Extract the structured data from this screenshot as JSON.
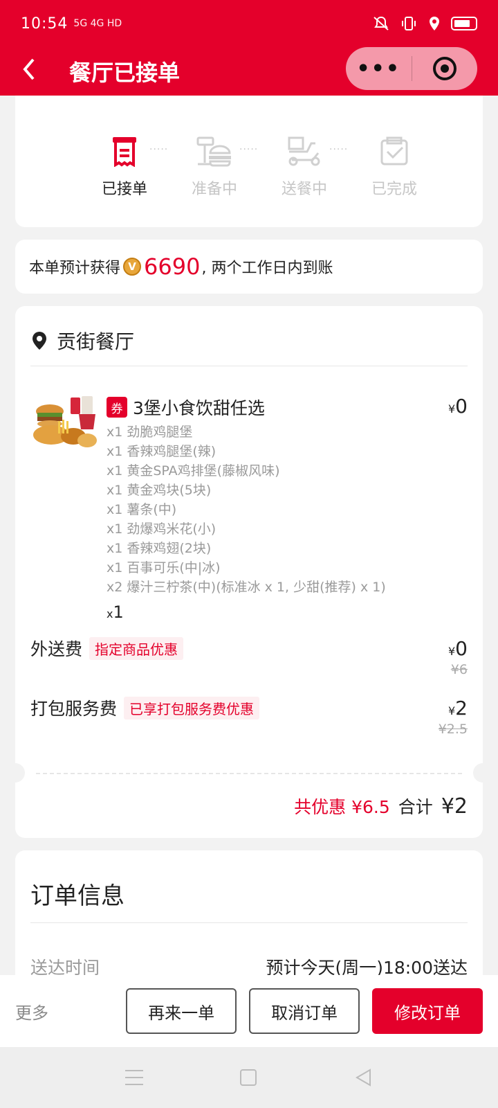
{
  "status_bar": {
    "time": "10:54",
    "signal_text": "5G 4G HD",
    "icons": [
      "mute-icon",
      "vibrate-icon",
      "location-icon",
      "battery-icon"
    ]
  },
  "nav": {
    "title": "餐厅已接单",
    "back_icon": "chevron-left-icon",
    "more_icon": "more-dots-icon",
    "close_icon": "target-icon"
  },
  "progress": {
    "steps": [
      {
        "label": "已接单",
        "icon": "receipt-icon",
        "active": true
      },
      {
        "label": "准备中",
        "icon": "burger-icon",
        "active": false
      },
      {
        "label": "送餐中",
        "icon": "delivery-scooter-icon",
        "active": false
      },
      {
        "label": "已完成",
        "icon": "done-check-icon",
        "active": false
      }
    ],
    "dots": "·····"
  },
  "points": {
    "prefix": "本单预计获得",
    "coin": "V",
    "amount": "6690",
    "suffix": ", 两个工作日内到账"
  },
  "order": {
    "restaurant": "贡街餐厅",
    "item": {
      "coupon": "券",
      "name": "3堡小食饮甜任选",
      "currency": "¥",
      "price": "0",
      "sub_items": [
        "x1 劲脆鸡腿堡",
        "x1 香辣鸡腿堡(辣)",
        "x1 黄金SPA鸡排堡(藤椒风味)",
        "x1 黄金鸡块(5块)",
        "x1 薯条(中)",
        "x1 劲爆鸡米花(小)",
        "x1 香辣鸡翅(2块)",
        "x1 百事可乐(中|冰)",
        "x2 爆汁三柠茶(中)(标准冰 x 1, 少甜(推荐) x 1)"
      ],
      "qty_prefix": "x",
      "qty": "1"
    },
    "delivery_fee": {
      "label": "外送费",
      "tag": "指定商品优惠",
      "currency": "¥",
      "price": "0",
      "original": "¥6"
    },
    "packing_fee": {
      "label": "打包服务费",
      "tag": "已享打包服务费优惠",
      "currency": "¥",
      "price": "2",
      "original": "¥2.5"
    },
    "discount_text": "共优惠 ¥6.5",
    "total_label": "合计",
    "total_value": "¥2"
  },
  "info": {
    "title": "订单信息",
    "delivery_time_label": "送达时间",
    "delivery_time_value": "预计今天(周一)18:00送达"
  },
  "actions": {
    "more": "更多",
    "reorder": "再来一单",
    "cancel": "取消订单",
    "modify": "修改订单"
  },
  "colors": {
    "brand_red": "#e4002b",
    "bg": "#f2f2f2",
    "muted": "#9a9a9a"
  }
}
